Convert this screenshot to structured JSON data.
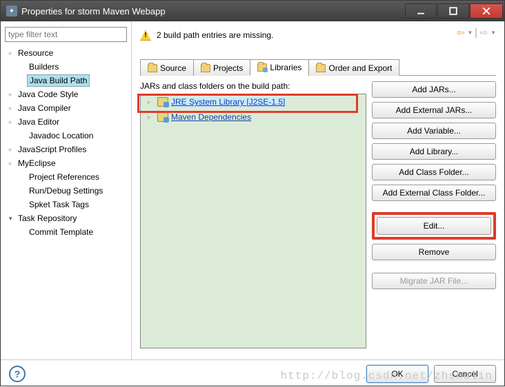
{
  "window": {
    "title": "Properties for storm Maven Webapp"
  },
  "filter": {
    "placeholder": "type filter text"
  },
  "tree_items": [
    {
      "label": "Resource",
      "expandable": true,
      "child": false
    },
    {
      "label": "Builders",
      "expandable": false,
      "child": true
    },
    {
      "label": "Java Build Path",
      "expandable": false,
      "child": true,
      "selected": true
    },
    {
      "label": "Java Code Style",
      "expandable": true,
      "child": false
    },
    {
      "label": "Java Compiler",
      "expandable": true,
      "child": false
    },
    {
      "label": "Java Editor",
      "expandable": true,
      "child": false
    },
    {
      "label": "Javadoc Location",
      "expandable": false,
      "child": true
    },
    {
      "label": "JavaScript Profiles",
      "expandable": true,
      "child": false
    },
    {
      "label": "MyEclipse",
      "expandable": true,
      "child": false
    },
    {
      "label": "Project References",
      "expandable": false,
      "child": true
    },
    {
      "label": "Run/Debug Settings",
      "expandable": false,
      "child": true
    },
    {
      "label": "Spket Task Tags",
      "expandable": false,
      "child": true
    },
    {
      "label": "Task Repository",
      "expandable": true,
      "child": false,
      "expanded": true
    },
    {
      "label": "Commit Template",
      "expandable": false,
      "child": true
    }
  ],
  "warning": "2 build path entries are missing.",
  "tabs": [
    {
      "label": "Source"
    },
    {
      "label": "Projects"
    },
    {
      "label": "Libraries",
      "active": true
    },
    {
      "label": "Order and Export"
    }
  ],
  "panel_label": "JARs and class folders on the build path:",
  "libs": [
    {
      "label": "JRE System Library [J2SE-1.5]",
      "selected": true
    },
    {
      "label": "Maven Dependencies",
      "selected": false
    }
  ],
  "buttons": {
    "add_jars": "Add JARs...",
    "add_ext_jars": "Add External JARs...",
    "add_var": "Add Variable...",
    "add_lib": "Add Library...",
    "add_cf": "Add Class Folder...",
    "add_ext_cf": "Add External Class Folder...",
    "edit": "Edit...",
    "remove": "Remove",
    "migrate": "Migrate JAR File..."
  },
  "dialog": {
    "ok": "OK",
    "cancel": "Cancel"
  },
  "watermark": "http://blog.csdn.net/zhshulin"
}
